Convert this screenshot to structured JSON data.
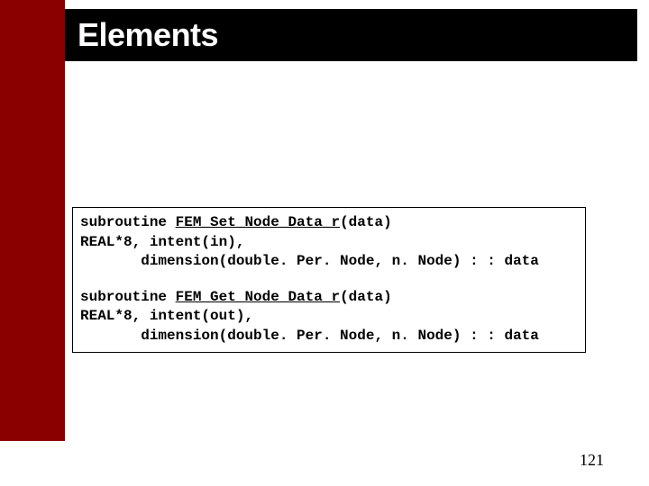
{
  "slide": {
    "title": "Elements",
    "page_number": "121"
  },
  "code": {
    "block1": {
      "line1_prefix": "subroutine ",
      "line1_func": "FEM_Set_Node_Data_r",
      "line1_suffix": "(data)",
      "line2": "REAL*8, intent(in),",
      "line3": "       dimension(double. Per. Node, n. Node) : : data"
    },
    "block2": {
      "line1_prefix": "subroutine ",
      "line1_func": "FEM_Get_Node_Data_r",
      "line1_suffix": "(data)",
      "line2": "REAL*8, intent(out),",
      "line3": "       dimension(double. Per. Node, n. Node) : : data"
    }
  }
}
